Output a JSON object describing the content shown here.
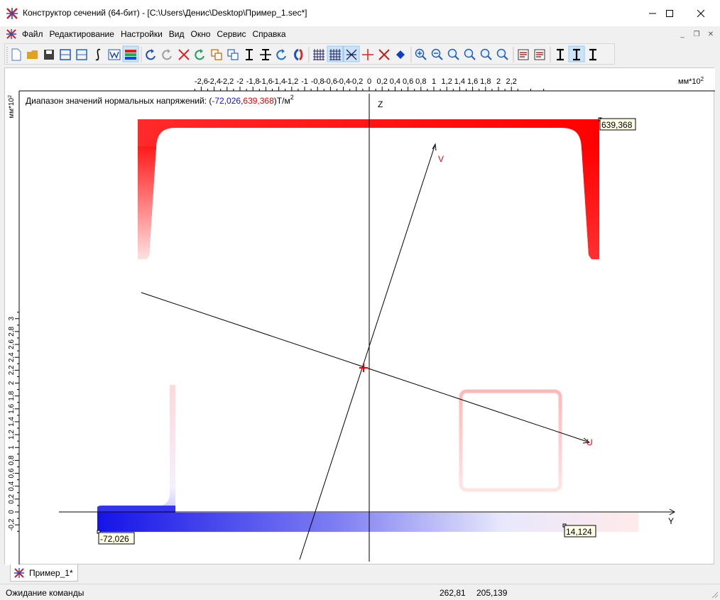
{
  "window": {
    "title": "Конструктор сечений (64-бит) - [C:\\Users\\Денис\\Desktop\\Пример_1.sec*]",
    "controls": {
      "minimize": "—",
      "maximize": "☐",
      "close": "✕"
    }
  },
  "menu": {
    "items": [
      "Файл",
      "Редактирование",
      "Настройки",
      "Вид",
      "Окно",
      "Сервис",
      "Справка"
    ]
  },
  "toolbar": {
    "buttons": [
      "new-icon",
      "open-icon",
      "save-icon",
      "section-icon",
      "calc-icon",
      "integral-icon",
      "word-icon",
      "colormap-icon",
      "sep",
      "undo-icon",
      "redo-icon",
      "delete-icon",
      "rotate-icon",
      "pan-icon",
      "copy-icon",
      "ibeam-icon",
      "move-icon",
      "refresh-icon",
      "mirror-icon",
      "sep",
      "grid-icon",
      "snap-grid-icon",
      "axes-icon",
      "cross-icon",
      "principal-axes-icon",
      "point-icon",
      "sep",
      "zoom-in-icon",
      "zoom-out-icon",
      "zoom-fit-icon",
      "zoom-window-icon",
      "zoom-prev-icon",
      "zoom-all-icon",
      "sep",
      "report-icon",
      "print-icon",
      "sep",
      "section-top-icon",
      "section-mid-icon",
      "section-bot-icon"
    ],
    "active": [
      "colormap-icon",
      "snap-grid-icon",
      "axes-icon",
      "section-mid-icon"
    ]
  },
  "drawing": {
    "range_label": {
      "prefix": "Диапазон значений нормальных напряжений: (",
      "min": "-72,026",
      "comma": ",",
      "max": "639,368",
      "suffix": ")Т/м",
      "exp": "2"
    },
    "colors": {
      "min": "#1010e8",
      "max": "#e80000"
    },
    "x_ticks": [
      "-2,6",
      "-2,4",
      "-2,2",
      "-2",
      "-1,8",
      "-1,6",
      "-1,4",
      "-1,2",
      "-1",
      "-0,8",
      "-0,6",
      "-0,4",
      "-0,2",
      "0",
      "0,2",
      "0,4",
      "0,6",
      "0,8",
      "1",
      "1,2",
      "1,4",
      "1,6",
      "1,8",
      "2",
      "2,2"
    ],
    "x_unit": "мм*10",
    "x_unit_exp": "2",
    "y_ticks": [
      "3",
      "2,8",
      "2,6",
      "2,4",
      "2,2",
      "2",
      "1,8",
      "1,6",
      "1,4",
      "1,2",
      "1",
      "0,8",
      "0,6",
      "0,4",
      "0,2",
      "0",
      "-0,2"
    ],
    "y_unit": "мм*10",
    "y_unit_exp": "2",
    "axis_z": "Z",
    "axis_y": "Y",
    "axis_v": "V",
    "axis_u": "U",
    "value_tags": {
      "top_right": "639,368",
      "bottom_left": "-72,026",
      "bottom_right": "14,124"
    }
  },
  "tabs": [
    {
      "label": "Пример_1*"
    }
  ],
  "status": {
    "message": "Ожидание команды",
    "coord_x": "262,81",
    "coord_y": "205,139"
  }
}
